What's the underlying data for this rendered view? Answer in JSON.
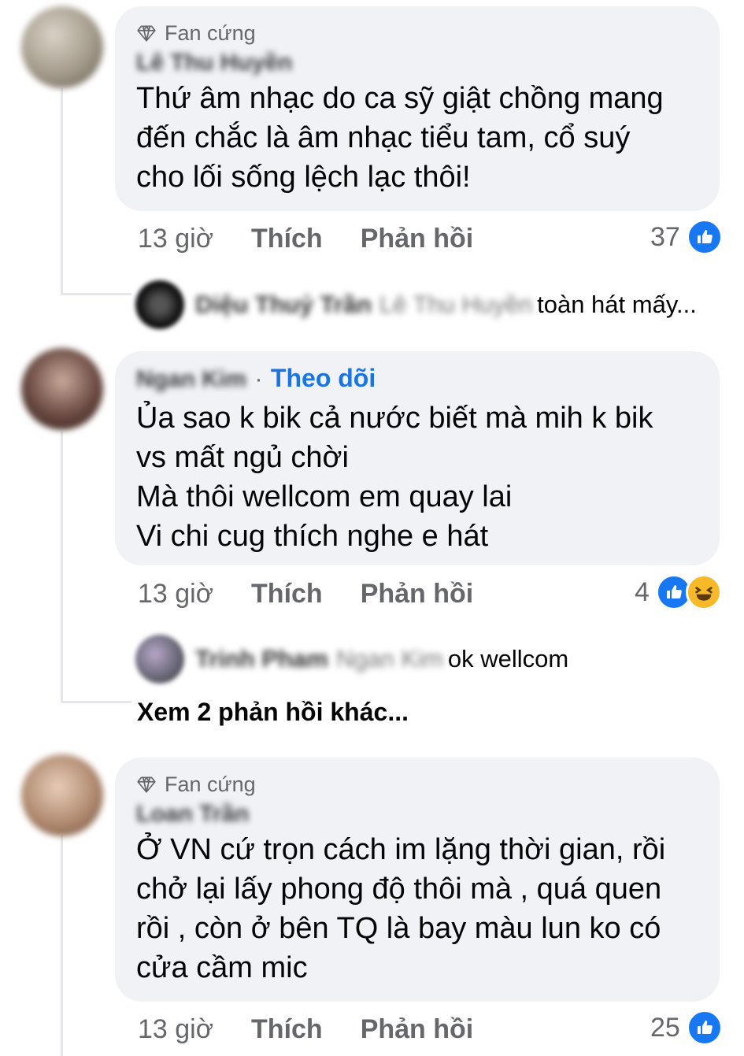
{
  "comments": [
    {
      "badge": "Fan cứng",
      "author": "Lê Thu Huyền",
      "text": "Thứ âm nhạc do ca sỹ giật chồng mang\nđến chắc là âm nhạc tiểu tam, cổ suý\ncho lối sống lệch lạc thôi!",
      "time": "13 giờ",
      "like_label": "Thích",
      "reply_label": "Phản hồi",
      "reaction_count": "37",
      "reply": {
        "author": "Diệu Thuỷ Trần",
        "mention": "Lê Thu Huyền",
        "text": "toàn hát mấy..."
      }
    },
    {
      "author": "Ngan Kim",
      "follow_label": "Theo dõi",
      "text": "Ủa sao k bik cả nước biết mà mih k bik\nvs mất ngủ chời\nMà thôi wellcom em quay lai\nVi chi cug thích nghe e hát",
      "time": "13 giờ",
      "like_label": "Thích",
      "reply_label": "Phản hồi",
      "reaction_count": "4",
      "reply": {
        "author": "Trinh Pham",
        "mention": "Ngan Kim",
        "text": "ok wellcom"
      },
      "more_replies": "Xem 2 phản hồi khác..."
    },
    {
      "badge": "Fan cứng",
      "author": "Loan Trần",
      "text": "Ở VN cứ trọn cách im lặng thời gian, rồi\nchở lại lấy phong độ thôi mà , quá quen\nrồi , còn ở bên TQ là bay màu lun ko có\ncửa cầm mic",
      "time": "13 giờ",
      "like_label": "Thích",
      "reply_label": "Phản hồi",
      "reaction_count": "25"
    }
  ],
  "colors": {
    "bubble": "#f0f2f5",
    "meta": "#65676b",
    "link": "#1b74e4",
    "like": "#1877f2",
    "haha": "#f7b928"
  }
}
